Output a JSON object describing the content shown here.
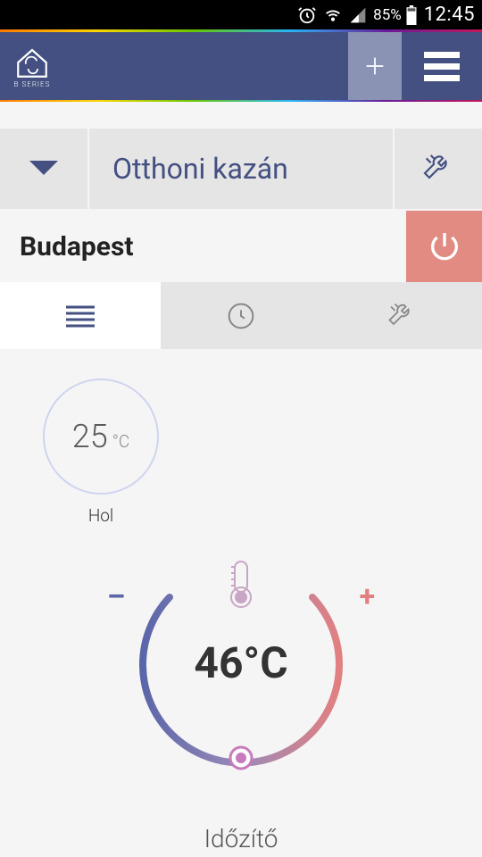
{
  "status": {
    "battery_pct": "85%",
    "time": "12:45"
  },
  "header": {
    "brand": "B SERIES"
  },
  "device": {
    "name": "Otthoni kazán"
  },
  "location": {
    "name": "Budapest"
  },
  "small_circle": {
    "value": "25",
    "unit": "°C",
    "label": "Hol"
  },
  "dial": {
    "minus": "–",
    "plus": "+",
    "value_display": "46°C"
  },
  "footer": {
    "timer_label": "Időzítő"
  }
}
